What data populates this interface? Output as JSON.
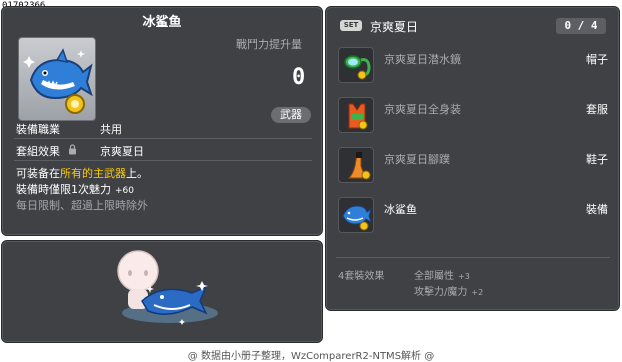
{
  "item_id": "01702366",
  "item": {
    "name": "冰鲨鱼",
    "power_label": "戰鬥力提升量",
    "power_value": "0",
    "type_badge": "武器",
    "job_label": "裝備職業",
    "job_value": "共用",
    "set_effect_label": "套組效果",
    "set_effect_value": "京爽夏日",
    "desc_line1_pre": "可装备在",
    "desc_line1_hl": "所有的主武器",
    "desc_line1_post": "上。",
    "desc_line2": "裝備時僅限1次魅力",
    "desc_line2_bonus": "+60",
    "desc_line3": "每日限制、超過上限時除外"
  },
  "set": {
    "badge": "SET",
    "title": "京爽夏日",
    "count": "0 / 4",
    "items": [
      {
        "name": "京爽夏日潜水鏡",
        "slot": "帽子",
        "owned": false,
        "icon": "snorkel-goggles-icon"
      },
      {
        "name": "京爽夏日全身装",
        "slot": "套服",
        "owned": false,
        "icon": "swimsuit-icon"
      },
      {
        "name": "京爽夏日腳蹼",
        "slot": "鞋子",
        "owned": false,
        "icon": "flipper-icon"
      },
      {
        "name": "冰鲨鱼",
        "slot": "裝備",
        "owned": true,
        "icon": "ice-shark-icon"
      }
    ],
    "effect_label": "4套裝效果",
    "effect_line1": "全部屬性",
    "effect_line1_bonus": "+3",
    "effect_line2": "攻擊力/魔力",
    "effect_line2_bonus": "+2"
  },
  "footer": "@ 数据由小册子整理，WzComparerR2-NTMS解析 @",
  "colors": {
    "panel_bg": "#3f4145",
    "highlight": "#ffcc00",
    "dim_text": "#a8abb0"
  }
}
